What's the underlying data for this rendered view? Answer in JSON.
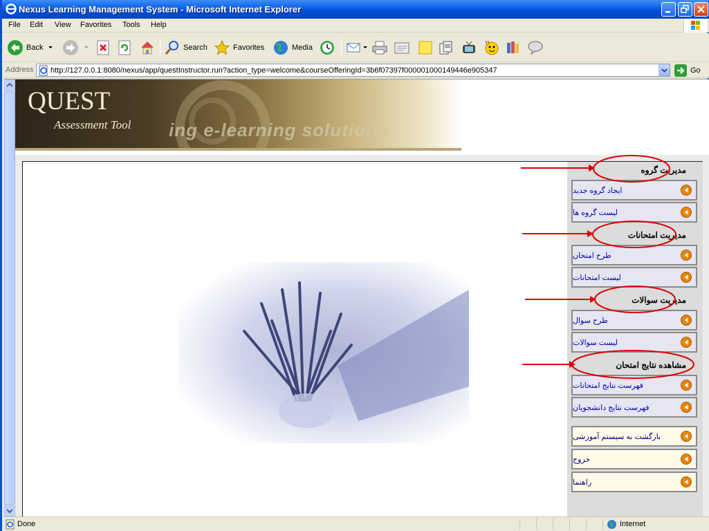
{
  "window": {
    "title": "Nexus Learning Management System - Microsoft Internet Explorer"
  },
  "menubar": {
    "items": [
      "File",
      "Edit",
      "View",
      "Favorites",
      "Tools",
      "Help"
    ]
  },
  "toolbar": {
    "back_label": "Back",
    "search_label": "Search",
    "favorites_label": "Favorites",
    "media_label": "Media"
  },
  "address": {
    "label": "Address",
    "url": "http://127.0.0.1:8080/nexus/app/questInstructor.run?action_type=welcome&courseOfferingId=3b6f07397f000001000149446e905347",
    "go_label": "Go"
  },
  "banner": {
    "logo_text": "QUEST",
    "subtitle": "Assessment Tool",
    "tagline": "ing e-learning solutions"
  },
  "side_menu": {
    "group_mgmt": {
      "title": "مدیریت گروه",
      "items": [
        "ایجاد گروه جدید",
        "لیست گروه ها"
      ]
    },
    "exam_mgmt": {
      "title": "مدیریت امتحانات",
      "items": [
        "طرح امتحان",
        "لیست امتحانات"
      ]
    },
    "question_mgmt": {
      "title": "مدیریت سوالات",
      "items": [
        "طرح سوال",
        "لیست سوالات"
      ]
    },
    "results": {
      "title": "مشاهده نتایج امتحان",
      "items": [
        "فهرست نتایج امتحانات",
        "فهرست نتایج دانشجویان"
      ]
    },
    "footer_items": [
      "بازگشت به سیستم آموزشی",
      "خروج",
      "راهنما"
    ]
  },
  "statusbar": {
    "status": "Done",
    "zone": "Internet"
  },
  "colors": {
    "titlebar": "#0a5fe6",
    "annotation_red": "#e00000",
    "menu_link": "#0000b0",
    "arrow_orange": "#e8840e"
  }
}
